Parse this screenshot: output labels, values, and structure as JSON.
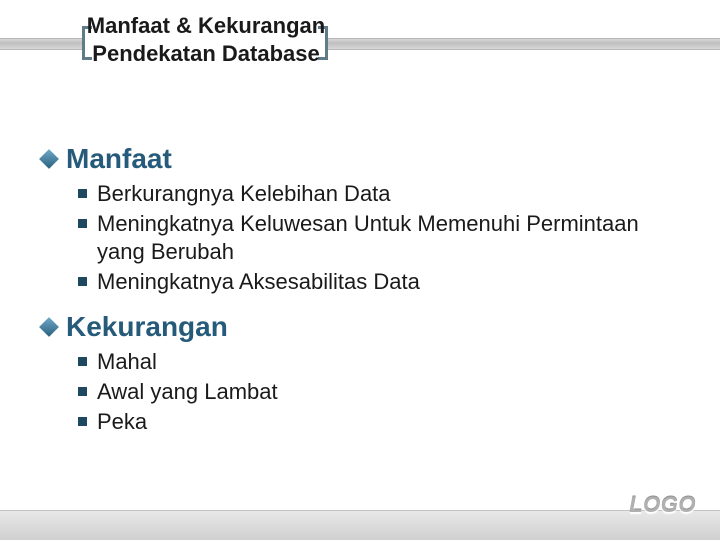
{
  "title": "Manfaat & Kekurangan Pendekatan Database",
  "sections": [
    {
      "heading": "Manfaat",
      "items": [
        "Berkurangnya Kelebihan Data",
        "Meningkatnya Keluwesan Untuk Memenuhi Permintaan yang Berubah",
        " Meningkatnya Aksesabilitas Data"
      ]
    },
    {
      "heading": "Kekurangan",
      "items": [
        "Mahal",
        "Awal yang Lambat",
        "Peka"
      ]
    }
  ],
  "footer": {
    "logo": "LOGO"
  }
}
